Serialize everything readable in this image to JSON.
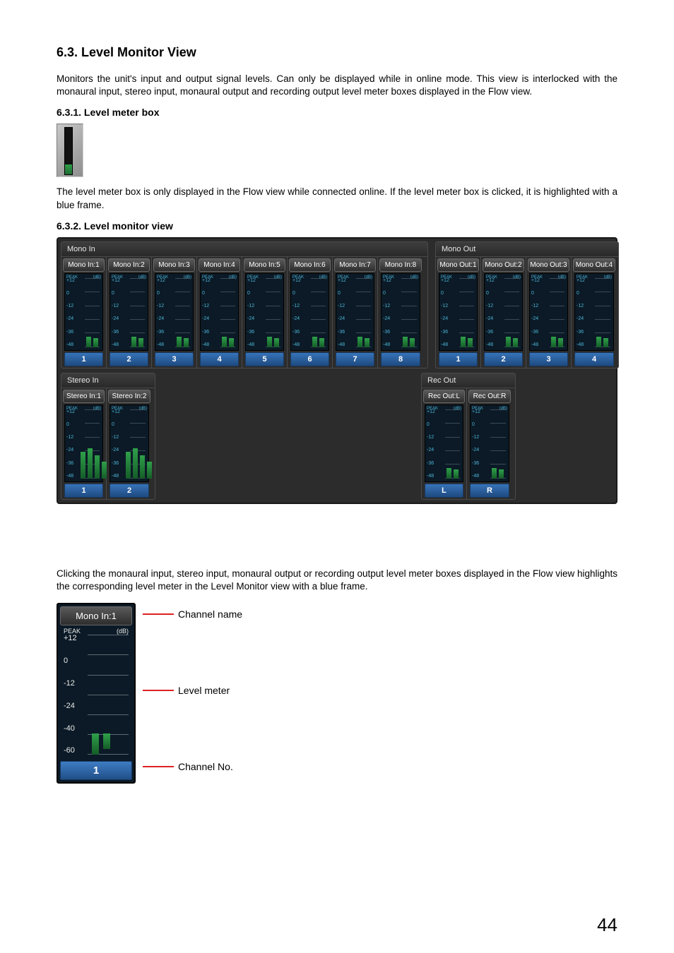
{
  "page_number": "44",
  "sec63": {
    "heading": "6.3. Level Monitor View",
    "body": "Monitors the unit's input and output signal levels. Can only be displayed while in online mode. This view is interlocked with the monaural input, stereo input, monaural output and recording output level meter boxes displayed in the Flow view."
  },
  "sec631": {
    "heading": "6.3.1. Level meter box",
    "body": "The level meter box is only displayed in the Flow view while connected online. If the level meter box is clicked, it is highlighted with a blue frame."
  },
  "sec632": {
    "heading": "6.3.2. Level monitor view",
    "body": "Clicking the monaural input, stereo input, monaural output or recording output level meter boxes displayed in the Flow view highlights the corresponding level meter in the Level Monitor view with a blue frame."
  },
  "meter_scale": [
    "+12",
    "0",
    "-12",
    "-24",
    "-36",
    "-48"
  ],
  "annotated_scale": [
    "+12",
    "0",
    "-12",
    "-24",
    "-40",
    "-60"
  ],
  "meter_peak_label": "PEAK",
  "meter_db_label": "(dB)",
  "monitor": {
    "mono_in": {
      "title": "Mono In",
      "channels": [
        {
          "name": "Mono In:1",
          "no": "1"
        },
        {
          "name": "Mono In:2",
          "no": "2"
        },
        {
          "name": "Mono In:3",
          "no": "3"
        },
        {
          "name": "Mono In:4",
          "no": "4"
        },
        {
          "name": "Mono In:5",
          "no": "5"
        },
        {
          "name": "Mono In:6",
          "no": "6"
        },
        {
          "name": "Mono In:7",
          "no": "7"
        },
        {
          "name": "Mono In:8",
          "no": "8"
        }
      ]
    },
    "mono_out": {
      "title": "Mono Out",
      "channels": [
        {
          "name": "Mono Out:1",
          "no": "1"
        },
        {
          "name": "Mono Out:2",
          "no": "2"
        },
        {
          "name": "Mono Out:3",
          "no": "3"
        },
        {
          "name": "Mono Out:4",
          "no": "4"
        }
      ]
    },
    "stereo_in": {
      "title": "Stereo In",
      "channels": [
        {
          "name": "Stereo In:1",
          "no": "1"
        },
        {
          "name": "Stereo In:2",
          "no": "2"
        }
      ]
    },
    "rec_out": {
      "title": "Rec Out",
      "channels": [
        {
          "name": "Rec Out:L",
          "no": "L"
        },
        {
          "name": "Rec Out:R",
          "no": "R"
        }
      ]
    }
  },
  "annotated": {
    "channel_name": "Mono In:1",
    "channel_no": "1",
    "peak_label": "PEAK",
    "db_label": "(dB)",
    "label_channel_name": "Channel name",
    "label_level_meter": "Level meter",
    "label_channel_no": "Channel No."
  }
}
